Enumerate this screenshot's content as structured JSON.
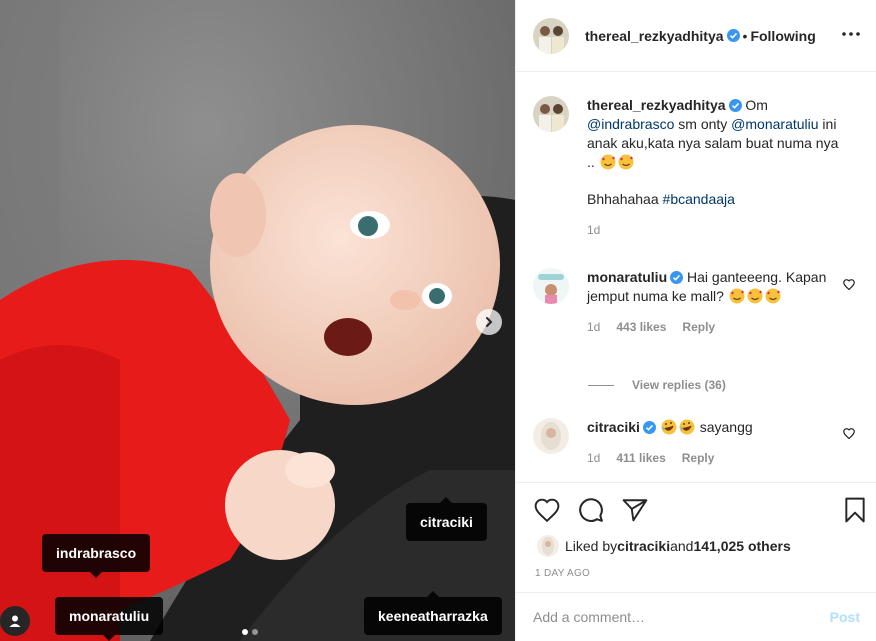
{
  "post": {
    "author": "thereal_rezkyadhitya",
    "follow_separator": "•",
    "follow_status": "Following"
  },
  "media": {
    "tags": [
      "citraciki",
      "indrabrasco",
      "monaratuliu",
      "keeneatharrazka"
    ],
    "carousel_total": 2,
    "carousel_active": 1
  },
  "caption": {
    "username": "thereal_rezkyadhitya",
    "text_1": " Om ",
    "mention_1": "@indrabrasco",
    "text_2": " sm onty ",
    "mention_2": "@monaratuliu",
    "text_3": " ini anak aku,kata nya salam buat numa nya .. ",
    "text_4": "Bhhahahaa ",
    "hashtag": "#bcandaaja",
    "time": "1d"
  },
  "comments": [
    {
      "username": "monaratuliu",
      "text": " Hai ganteeeng. Kapan jemput numa ke mall? ",
      "time": "1d",
      "likes": "443 likes",
      "reply": "Reply"
    },
    {
      "username": "citraciki",
      "text": " sayangg",
      "time": "1d",
      "likes": "411 likes",
      "reply": "Reply"
    }
  ],
  "view_replies": "View replies (36)",
  "likes_summary": {
    "prefix": "Liked by ",
    "user": "citraciki",
    "middle": " and ",
    "count": "141,025 others"
  },
  "timestamp": "1 DAY AGO",
  "add_comment": {
    "placeholder": "Add a comment…",
    "post_label": "Post"
  },
  "colors": {
    "verified": "#3897f0",
    "link": "#00376b",
    "muted": "#8e8e8e",
    "post_disabled": "#b2dffc",
    "shirt_red": "#e81b1b"
  }
}
